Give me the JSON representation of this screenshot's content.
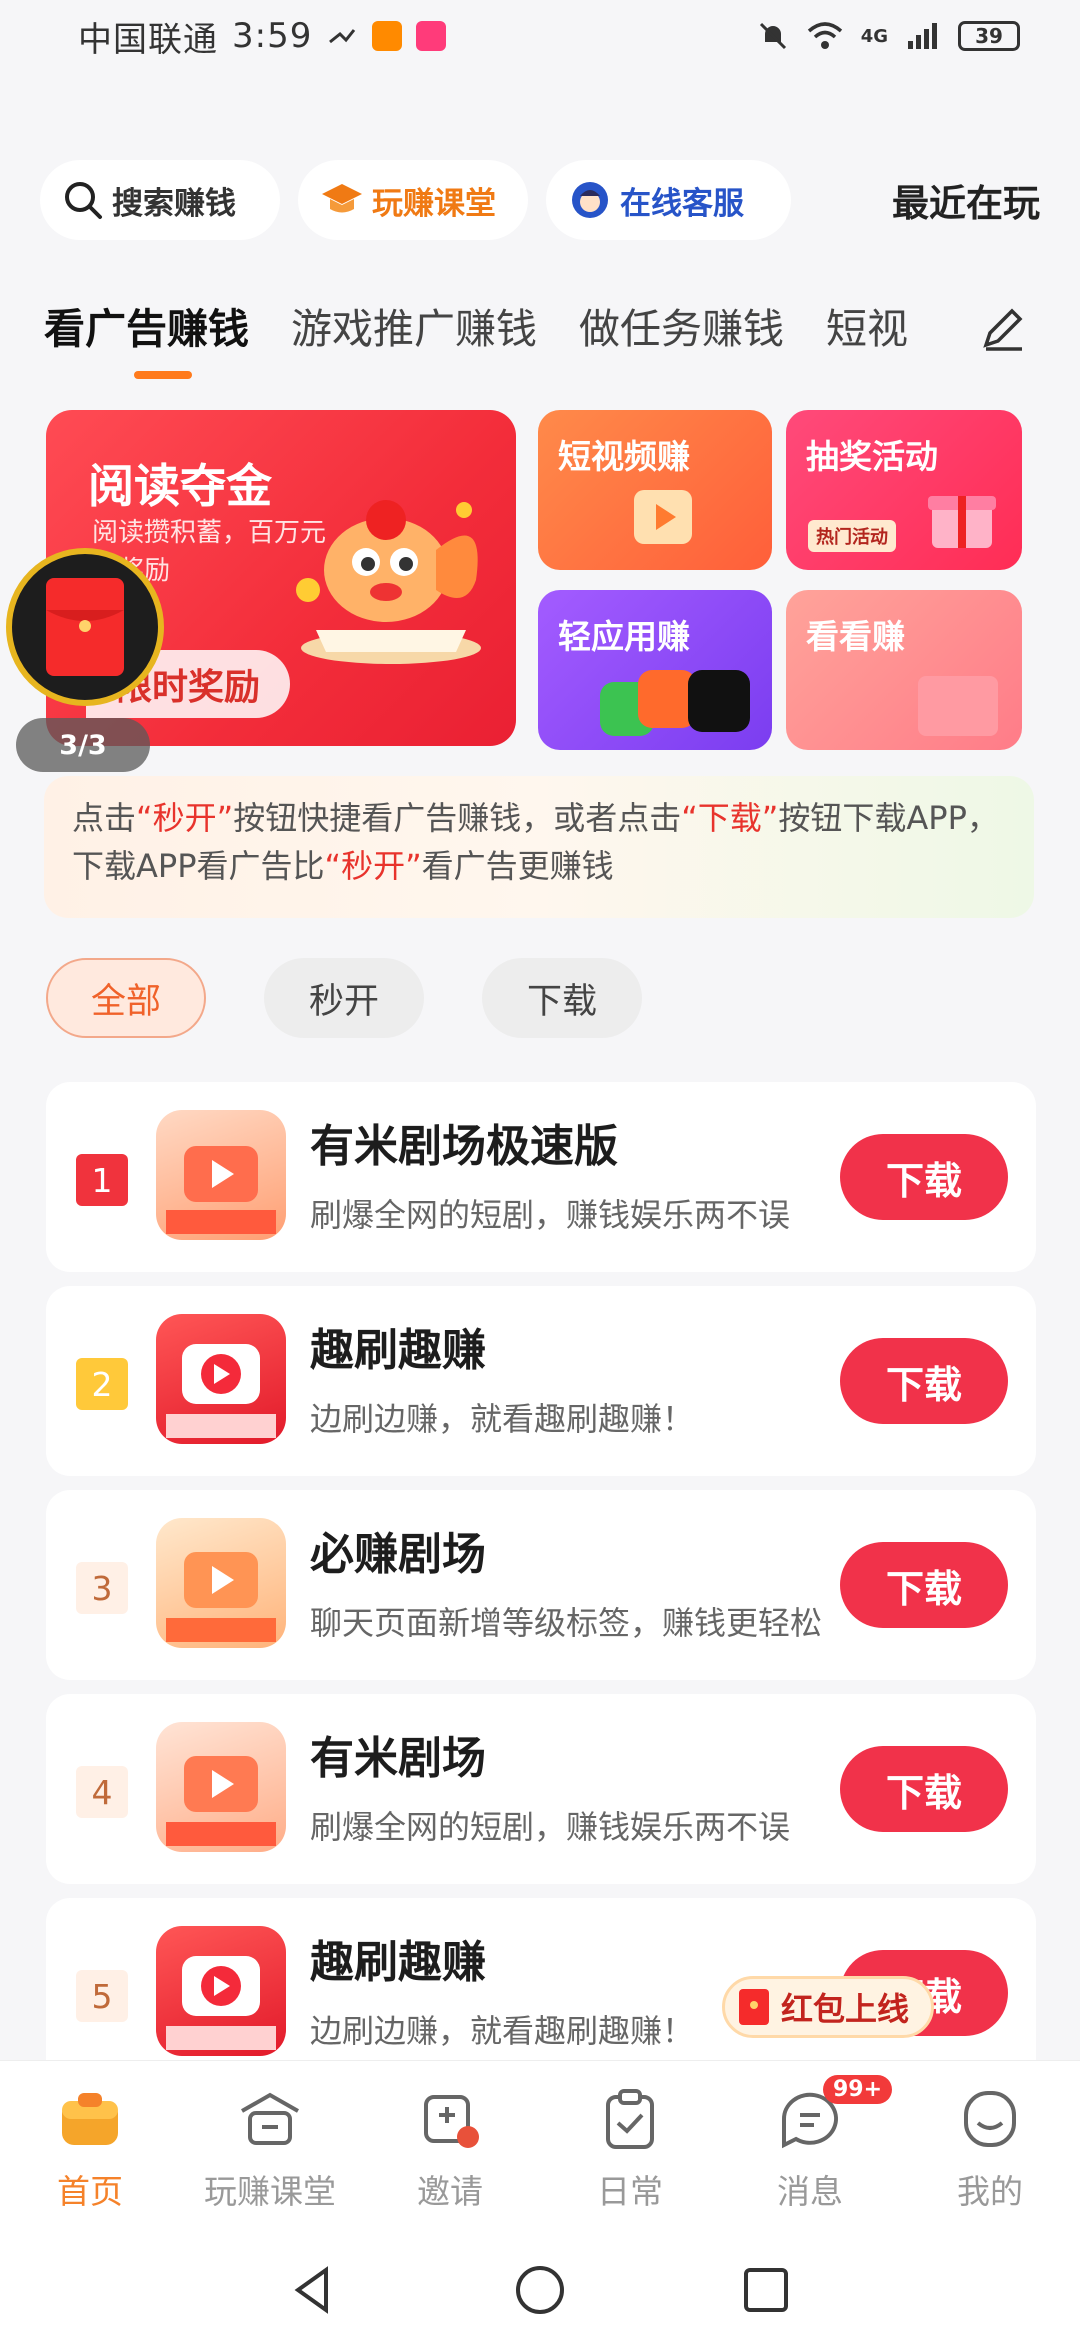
{
  "status_bar": {
    "carrier": "中国联通",
    "time": "3:59",
    "network": "4G",
    "battery": "39"
  },
  "top_bar": {
    "search_label": "搜索赚钱",
    "course_label": "玩赚课堂",
    "service_label": "在线客服",
    "recent_label": "最近在玩"
  },
  "categories": [
    "看广告赚钱",
    "游戏推广赚钱",
    "做任务赚钱",
    "短视"
  ],
  "banner": {
    "main_title": "阅读夺金",
    "main_sub": "阅读攒积蓄，百万元有奖励",
    "main_cta": "限时奖励",
    "pager": "3/3",
    "tiles": [
      "短视频赚",
      "抽奖活动",
      "轻应用赚",
      "看看赚"
    ],
    "hot_tag": "热门活动"
  },
  "notice": {
    "p1": "点击",
    "q1": "“秒开”",
    "p2": "按钮快捷看广告赚钱，或者点击",
    "q2": "“下载”",
    "p3": "按钮下载APP，下载APP看广告比",
    "q3": "“秒开”",
    "p4": "看广告更赚钱"
  },
  "filters": [
    "全部",
    "秒开",
    "下载"
  ],
  "apps": [
    {
      "rank": "1",
      "name": "有米剧场极速版",
      "desc": "刷爆全网的短剧，赚钱娱乐两不误",
      "action": "下载"
    },
    {
      "rank": "2",
      "name": "趣刷趣赚",
      "desc": "边刷边赚，就看趣刷趣赚！",
      "action": "下载"
    },
    {
      "rank": "3",
      "name": "必赚剧场",
      "desc": "聊天页面新增等级标签，赚钱更轻松",
      "action": "下载"
    },
    {
      "rank": "4",
      "name": "有米剧场",
      "desc": "刷爆全网的短剧，赚钱娱乐两不误",
      "action": "下载"
    },
    {
      "rank": "5",
      "name": "趣刷趣赚",
      "desc": "边刷边赚，就看趣刷趣赚！",
      "action": "下载"
    }
  ],
  "floating_hongbao": "红包上线",
  "bottom_nav": [
    {
      "label": "首页",
      "icon": "home-icon"
    },
    {
      "label": "玩赚课堂",
      "icon": "school-icon"
    },
    {
      "label": "邀请",
      "icon": "invite-icon"
    },
    {
      "label": "日常",
      "icon": "clipboard-icon"
    },
    {
      "label": "消息",
      "icon": "message-icon",
      "badge": "99+"
    },
    {
      "label": "我的",
      "icon": "profile-icon"
    }
  ],
  "colors": {
    "accent": "#f5822a",
    "download_button": "#f1324a",
    "highlight_text": "#e8332c"
  }
}
